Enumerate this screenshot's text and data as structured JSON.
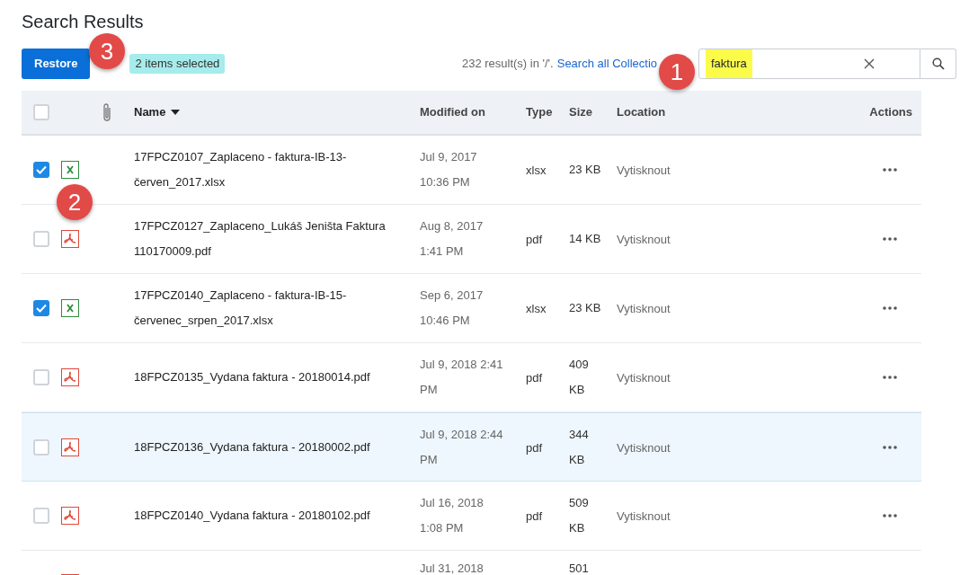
{
  "title": "Search Results",
  "toolbar": {
    "restore_button": "Restore",
    "selection_badge": "2 items selected",
    "result_summary": "232 result(s) in '/'.",
    "search_all_link": "Search all Collectio"
  },
  "search": {
    "value": "faktura",
    "value_highlighted": true
  },
  "table": {
    "header_checkbox": {
      "checked": false
    },
    "columns": [
      "Name",
      "Modified on",
      "Type",
      "Size",
      "Location",
      "Actions"
    ],
    "rows": [
      {
        "checked": true,
        "hovered": false,
        "kind": "xlsx",
        "name": "17FPCZ0107_Zaplaceno - faktura-IB-13-červen_2017.xlsx",
        "modified": "Jul 9, 2017 10:36 PM",
        "type": "xlsx",
        "size": "23 KB",
        "location": "Vytisknout"
      },
      {
        "checked": false,
        "hovered": false,
        "kind": "pdf",
        "name": "17FPCZ0127_Zaplaceno_Lukáš Jeništa Faktura 110170009.pdf",
        "modified": "Aug 8, 2017 1:41 PM",
        "type": "pdf",
        "size": "14 KB",
        "location": "Vytisknout"
      },
      {
        "checked": true,
        "hovered": false,
        "kind": "xlsx",
        "name": "17FPCZ0140_Zaplaceno - faktura-IB-15-červenec_srpen_2017.xlsx",
        "modified": "Sep 6, 2017 10:46 PM",
        "type": "xlsx",
        "size": "23 KB",
        "location": "Vytisknout"
      },
      {
        "checked": false,
        "hovered": false,
        "kind": "pdf",
        "name": "18FPCZ0135_Vydana faktura - 20180014.pdf",
        "modified": "Jul 9, 2018 2:41 PM",
        "type": "pdf",
        "size": "409 KB",
        "location": "Vytisknout"
      },
      {
        "checked": false,
        "hovered": true,
        "kind": "pdf",
        "name": "18FPCZ0136_Vydana faktura - 20180002.pdf",
        "modified": "Jul 9, 2018 2:44 PM",
        "type": "pdf",
        "size": "344 KB",
        "location": "Vytisknout"
      },
      {
        "checked": false,
        "hovered": false,
        "kind": "pdf",
        "name": "18FPCZ0140_Vydana faktura - 20180102.pdf",
        "modified": "Jul 16, 2018 1:08 PM",
        "type": "pdf",
        "size": "509 KB",
        "location": "Vytisknout"
      },
      {
        "kind": "pdf",
        "modified": "Jul 31, 2018",
        "size": "501"
      }
    ]
  },
  "callouts": [
    "3",
    "1",
    "2"
  ]
}
